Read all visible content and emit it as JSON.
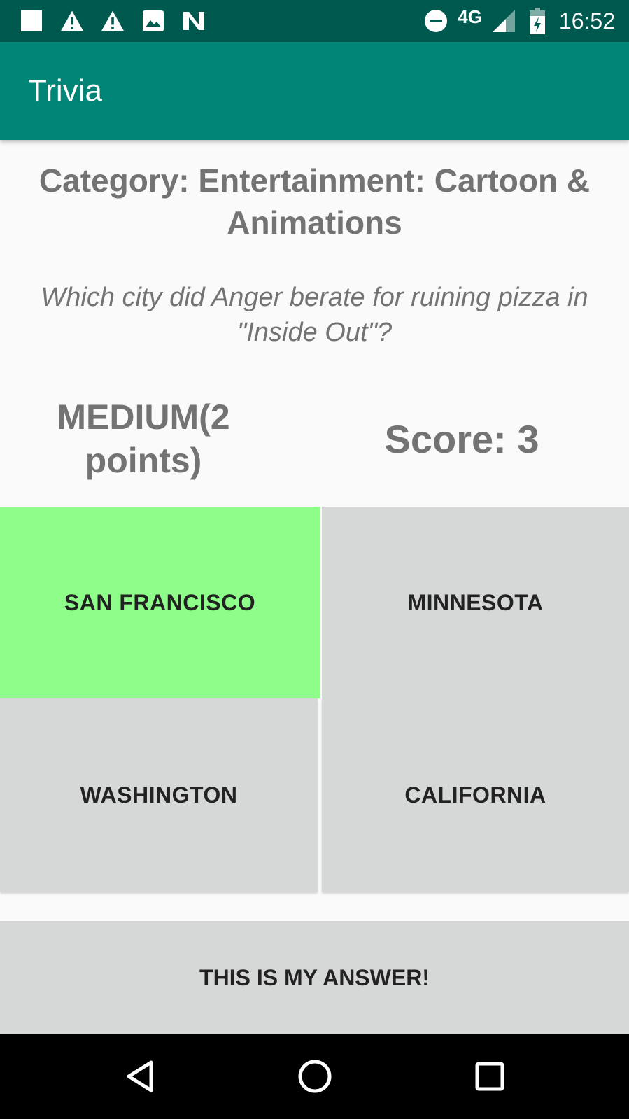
{
  "status_bar": {
    "time": "16:52",
    "network": "4G",
    "icons": [
      "square-notification-icon",
      "warning-icon",
      "warning-icon",
      "image-icon",
      "n-app-icon",
      "do-not-disturb-icon",
      "signal-icon",
      "battery-charging-icon"
    ]
  },
  "app_bar": {
    "title": "Trivia"
  },
  "quiz": {
    "category": "Category: Entertainment: Cartoon & Animations",
    "question": "Which city did Anger berate for ruining pizza in \"Inside Out\"?",
    "difficulty": "MEDIUM(2 points)",
    "score": "Score: 3"
  },
  "answers": [
    {
      "label": "SAN FRANCISCO",
      "selected": true
    },
    {
      "label": "MINNESOTA",
      "selected": false
    },
    {
      "label": "WASHINGTON",
      "selected": false
    },
    {
      "label": "CALIFORNIA",
      "selected": false
    }
  ],
  "submit_label": "THIS IS MY ANSWER!",
  "colors": {
    "status_bar": "#00594f",
    "app_bar": "#008577",
    "selected_answer": "#8efd89",
    "answer_bg": "#d6d7d7",
    "text_gray": "#737373"
  }
}
